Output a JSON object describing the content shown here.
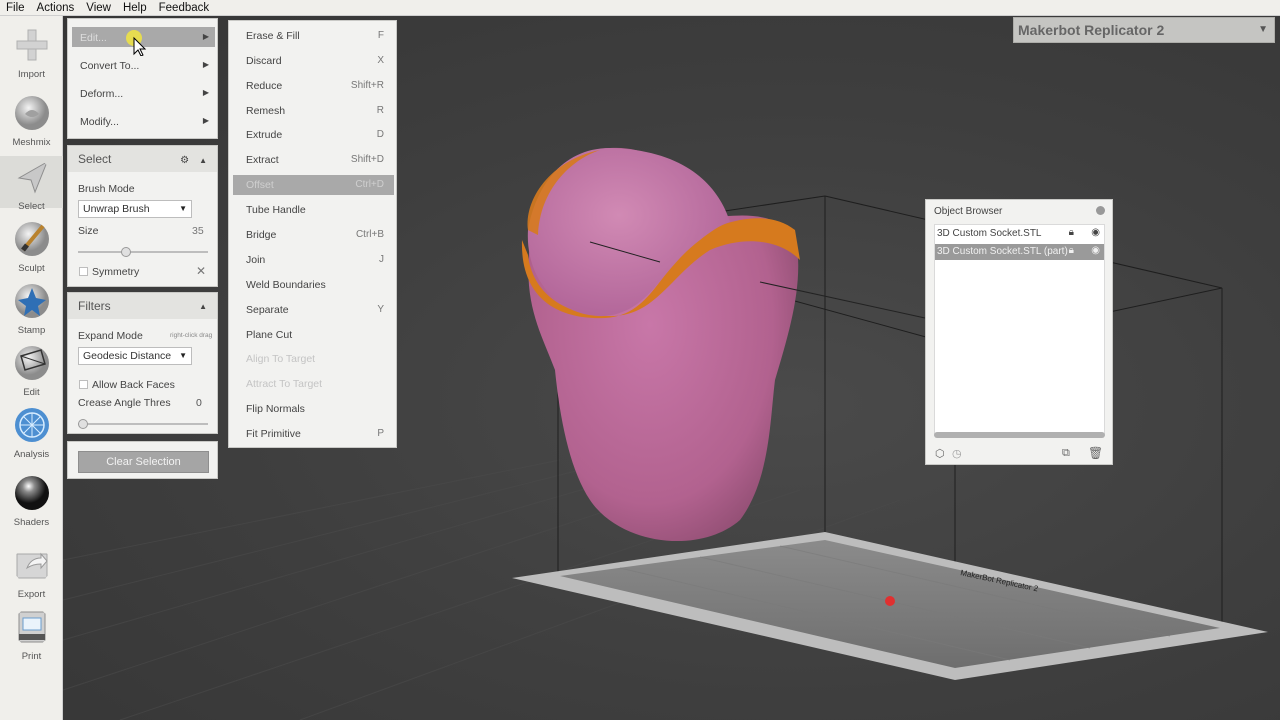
{
  "menubar": {
    "items": [
      "File",
      "Actions",
      "View",
      "Help",
      "Feedback"
    ]
  },
  "toolbar": {
    "tools": [
      {
        "label": "Import",
        "icon": "plus-icon"
      },
      {
        "label": "Meshmix",
        "icon": "meshmix-icon"
      },
      {
        "label": "Select",
        "icon": "select-arrow-icon",
        "active": true
      },
      {
        "label": "Sculpt",
        "icon": "brush-icon"
      },
      {
        "label": "Stamp",
        "icon": "stamp-icon"
      },
      {
        "label": "Edit",
        "icon": "edit-icon"
      },
      {
        "label": "Analysis",
        "icon": "analysis-icon"
      },
      {
        "label": "Shaders",
        "icon": "shader-sphere-icon"
      },
      {
        "label": "Export",
        "icon": "export-icon"
      },
      {
        "label": "Print",
        "icon": "printer-icon"
      }
    ]
  },
  "actions_menu": {
    "items": [
      {
        "label": "Edit...",
        "highlighted": true
      },
      {
        "label": "Convert To..."
      },
      {
        "label": "Deform..."
      },
      {
        "label": "Modify..."
      }
    ]
  },
  "select_panel": {
    "title": "Select",
    "brush_mode_label": "Brush Mode",
    "brush_mode_value": "Unwrap Brush",
    "size_label": "Size",
    "size_value": "35",
    "size_fraction": 0.36,
    "symmetry_label": "Symmetry"
  },
  "filters_panel": {
    "title": "Filters",
    "expand_mode_label": "Expand Mode",
    "expand_mode_hint": "right-click drag",
    "expand_mode_value": "Geodesic Distance",
    "allow_back_faces_label": "Allow Back Faces",
    "crease_label": "Crease Angle Thres",
    "crease_value": "0",
    "crease_fraction": 0.0
  },
  "clear_selection_label": "Clear Selection",
  "edit_submenu": {
    "items": [
      {
        "label": "Erase & Fill",
        "shortcut": "F"
      },
      {
        "label": "Discard",
        "shortcut": "X"
      },
      {
        "label": "Reduce",
        "shortcut": "Shift+R"
      },
      {
        "label": "Remesh",
        "shortcut": "R"
      },
      {
        "label": "Extrude",
        "shortcut": "D"
      },
      {
        "label": "Extract",
        "shortcut": "Shift+D"
      },
      {
        "label": "Offset",
        "shortcut": "Ctrl+D",
        "highlighted": true
      },
      {
        "label": "Tube Handle",
        "shortcut": ""
      },
      {
        "label": "Bridge",
        "shortcut": "Ctrl+B"
      },
      {
        "label": "Join",
        "shortcut": "J"
      },
      {
        "label": "Weld Boundaries",
        "shortcut": ""
      },
      {
        "label": "Separate",
        "shortcut": "Y"
      },
      {
        "label": "Plane Cut",
        "shortcut": ""
      },
      {
        "label": "Align To Target",
        "shortcut": "",
        "disabled": true
      },
      {
        "label": "Attract To Target",
        "shortcut": "",
        "disabled": true
      },
      {
        "label": "Flip Normals",
        "shortcut": ""
      },
      {
        "label": "Fit Primitive",
        "shortcut": "P"
      }
    ]
  },
  "printer": {
    "name": "Makerbot Replicator 2"
  },
  "object_browser": {
    "title": "Object Browser",
    "items": [
      {
        "label": "3D Custom Socket.STL",
        "selected": false
      },
      {
        "label": "3D Custom Socket.STL (part)",
        "selected": true
      }
    ]
  },
  "colors": {
    "mesh": "#c26d9e",
    "selection_band": "#d67a1e",
    "highlight": "#a9a9a9",
    "viewport_bg": "#3c3c3c"
  }
}
